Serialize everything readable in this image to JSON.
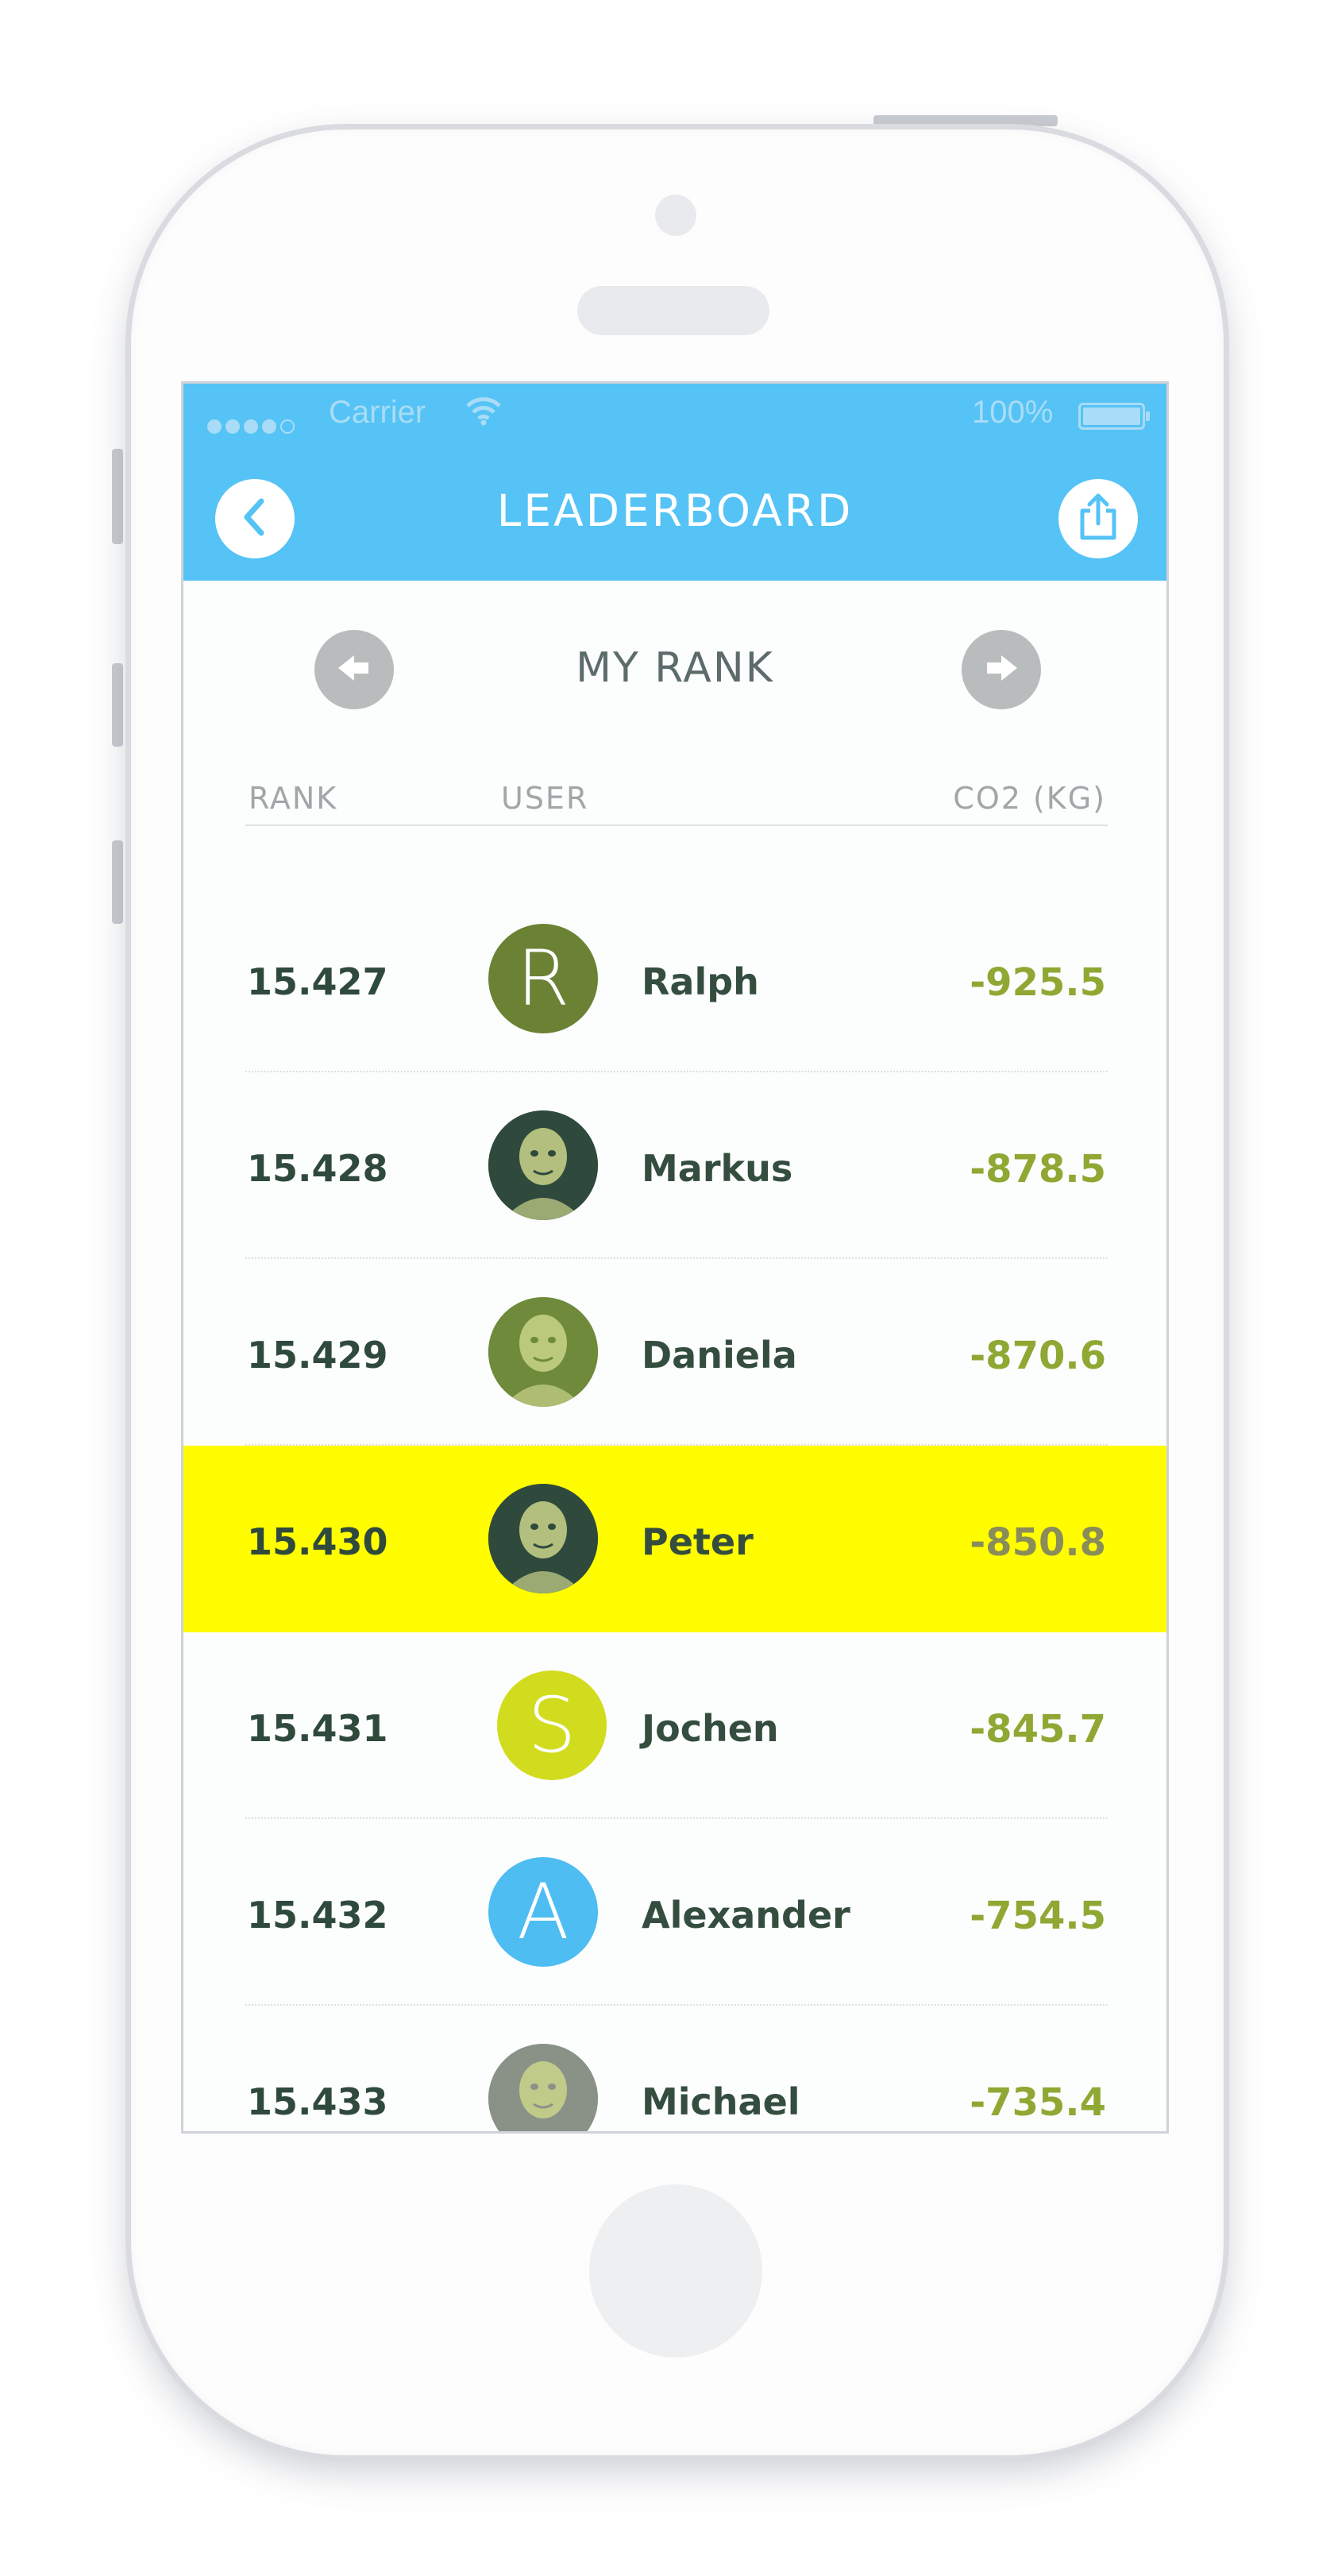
{
  "status_bar": {
    "carrier": "Carrier",
    "battery": "100%"
  },
  "app_bar": {
    "title": "LEADERBOARD"
  },
  "rank_nav": {
    "title": "MY RANK"
  },
  "table": {
    "columns": [
      "RANK",
      "USER",
      "CO2 (KG)"
    ],
    "rows": [
      {
        "rank": "15.427",
        "name": "Ralph",
        "co2": "-925.5",
        "avatar_type": "letter",
        "avatar_letter": "R",
        "avatar_color": "#6b8234"
      },
      {
        "rank": "15.428",
        "name": "Markus",
        "co2": "-878.5",
        "avatar_type": "photo",
        "avatar_color": "#2f4a3d"
      },
      {
        "rank": "15.429",
        "name": "Daniela",
        "co2": "-870.6",
        "avatar_type": "photo",
        "avatar_color": "#6e8a3a"
      },
      {
        "rank": "15.430",
        "name": "Peter",
        "co2": "-850.8",
        "avatar_type": "photo",
        "avatar_color": "#2f4a3d",
        "highlighted": true
      },
      {
        "rank": "15.431",
        "name": "Jochen",
        "co2": "-845.7",
        "avatar_type": "letter",
        "avatar_letter": "S",
        "avatar_color": "#d2dc1e"
      },
      {
        "rank": "15.432",
        "name": "Alexander",
        "co2": "-754.5",
        "avatar_type": "letter",
        "avatar_letter": "A",
        "avatar_color": "#4dbdf2"
      },
      {
        "rank": "15.433",
        "name": "Michael",
        "co2": "-735.4",
        "avatar_type": "photo",
        "avatar_color": "#8a9288"
      }
    ]
  },
  "colors": {
    "app_bar": "#55c3f5",
    "highlight": "#fffd00",
    "co2_text": "#8ea833",
    "name_text": "#344d3f"
  }
}
